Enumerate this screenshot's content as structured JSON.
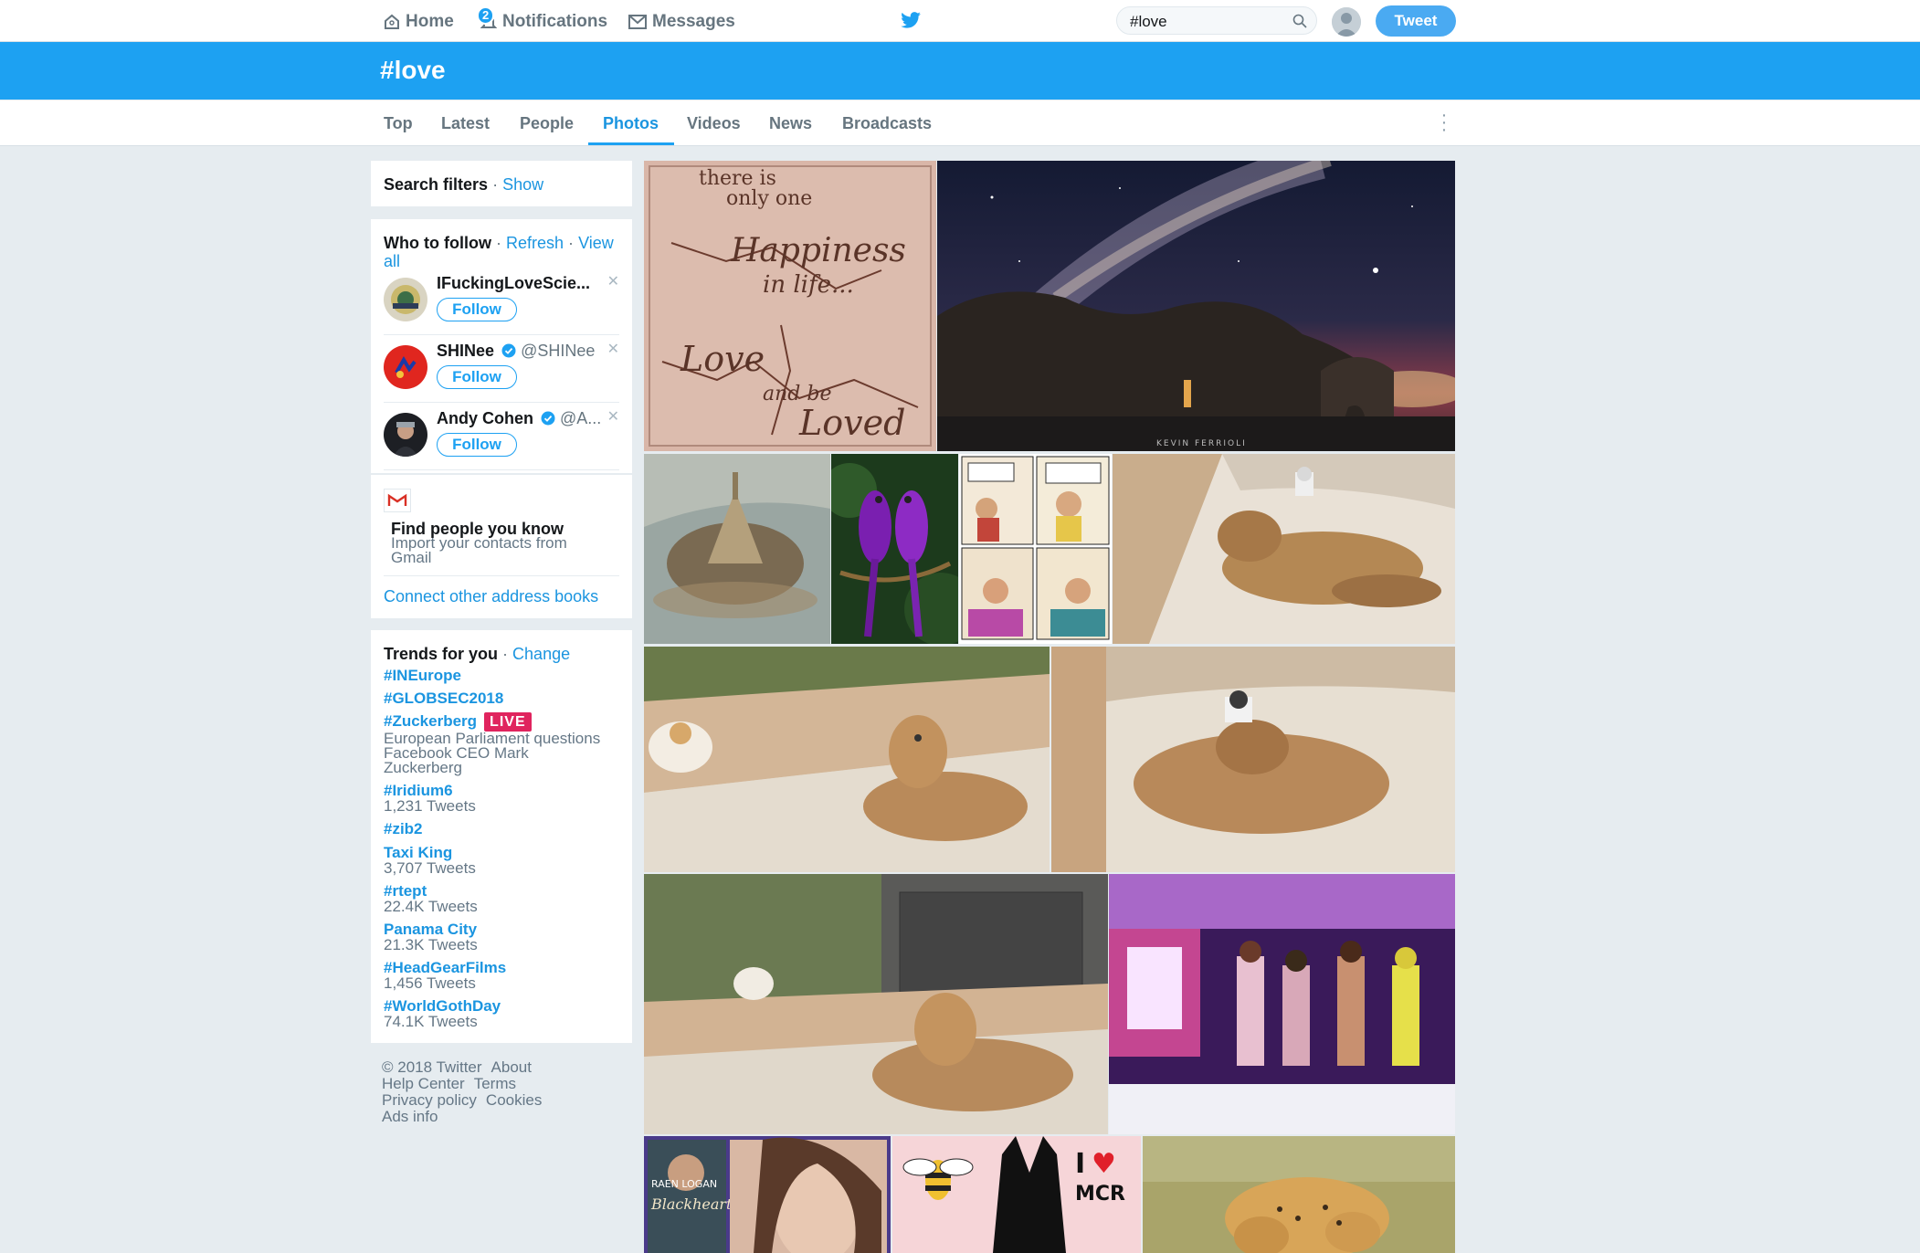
{
  "nav": {
    "home": "Home",
    "notifications": "Notifications",
    "notifications_count": "2",
    "messages": "Messages"
  },
  "search": {
    "value": "#love"
  },
  "tweet_button": "Tweet",
  "header": {
    "title": "#love"
  },
  "tabs": [
    {
      "label": "Top"
    },
    {
      "label": "Latest"
    },
    {
      "label": "People"
    },
    {
      "label": "Photos"
    },
    {
      "label": "Videos"
    },
    {
      "label": "News"
    },
    {
      "label": "Broadcasts"
    }
  ],
  "search_filters": {
    "title": "Search filters",
    "sep": "·",
    "show": "Show"
  },
  "who_to_follow": {
    "title": "Who to follow",
    "sep": "·",
    "refresh": "Refresh",
    "view": "View",
    "all": "all",
    "accounts": [
      {
        "name": "IFuckingLoveScie...",
        "handle": "",
        "follow": "Follow"
      },
      {
        "name": "SHINee",
        "handle": "@SHINee",
        "follow": "Follow"
      },
      {
        "name": "Andy Cohen",
        "handle": "@A...",
        "follow": "Follow"
      }
    ],
    "find_title": "Find people you know",
    "find_sub_1": "Import your contacts from",
    "find_sub_2": "Gmail",
    "connect": "Connect other address books"
  },
  "trends": {
    "title": "Trends for you",
    "sep": "·",
    "change": "Change",
    "live": "LIVE",
    "items": [
      {
        "name": "#INEurope"
      },
      {
        "name": "#GLOBSEC2018"
      },
      {
        "name": "#Zuckerberg",
        "meta_1": "European Parliament questions",
        "meta_2": "Facebook CEO Mark",
        "meta_3": "Zuckerberg"
      },
      {
        "name": "#Iridium6",
        "meta": "1,231 Tweets"
      },
      {
        "name": "#zib2"
      },
      {
        "name": "Taxi King",
        "meta": "3,707 Tweets"
      },
      {
        "name": "#rtept",
        "meta": "22.4K Tweets"
      },
      {
        "name": "Panama City",
        "meta": "21.3K Tweets"
      },
      {
        "name": "#HeadGearFilms",
        "meta": "1,456 Tweets"
      },
      {
        "name": "#WorldGothDay",
        "meta": "74.1K Tweets"
      }
    ]
  },
  "footer": {
    "copyright": "© 2018 Twitter",
    "about": "About",
    "help": "Help Center",
    "terms": "Terms",
    "privacy": "Privacy policy",
    "cookies": "Cookies",
    "ads": "Ads info"
  },
  "photos": {
    "happiness": {
      "line1": "there is",
      "line2": "only one",
      "line3": "Happiness",
      "line4": "in life...",
      "line5": "Love",
      "line6": "and be",
      "line7": "Loved"
    },
    "milky_way_credit": "KEVIN FERRIOLI",
    "book": {
      "author": "RAEN LOGAN",
      "title": "Blackheart"
    },
    "mcr": {
      "letter": "I",
      "heart": "♥",
      "text": "MCR"
    }
  }
}
